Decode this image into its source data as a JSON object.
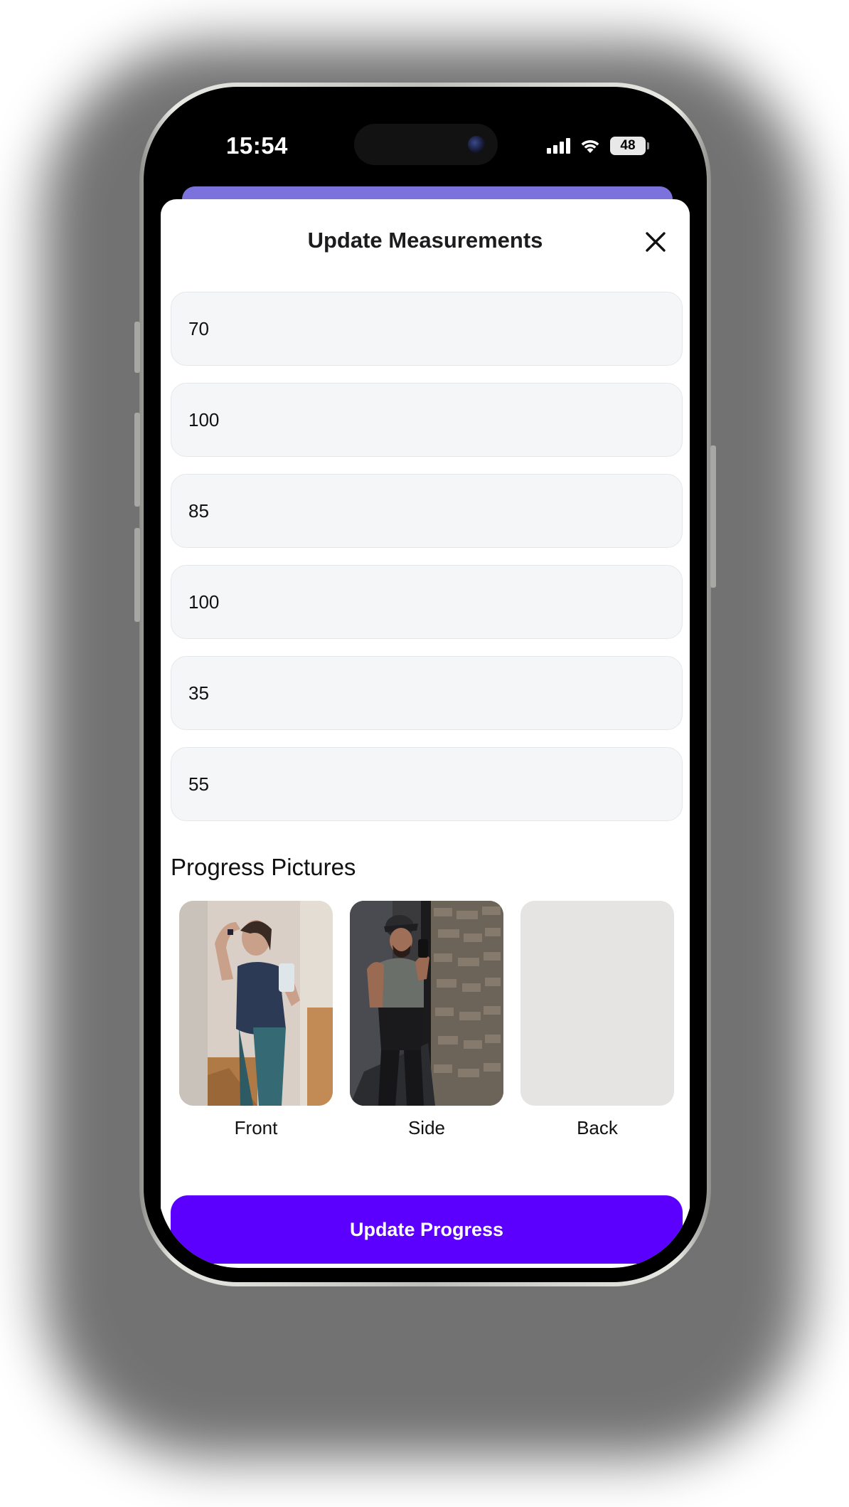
{
  "status_bar": {
    "time": "15:54",
    "battery": "48",
    "icons": [
      "cellular-signal-icon",
      "wifi-icon",
      "battery-icon"
    ]
  },
  "modal": {
    "title": "Update Measurements",
    "close_icon": "close-icon"
  },
  "measurements": [
    {
      "value": "70"
    },
    {
      "value": "100"
    },
    {
      "value": "85"
    },
    {
      "value": "100"
    },
    {
      "value": "35"
    },
    {
      "value": "55"
    }
  ],
  "progress_pictures": {
    "title": "Progress Pictures",
    "items": [
      {
        "label": "Front"
      },
      {
        "label": "Side"
      },
      {
        "label": "Back"
      }
    ]
  },
  "actions": {
    "update_label": "Update Progress"
  },
  "colors": {
    "accent": "#5b00ff",
    "header_peek": "#7b72dc",
    "field_bg": "#f5f6f8",
    "empty_picture": "#e5e4e2"
  }
}
